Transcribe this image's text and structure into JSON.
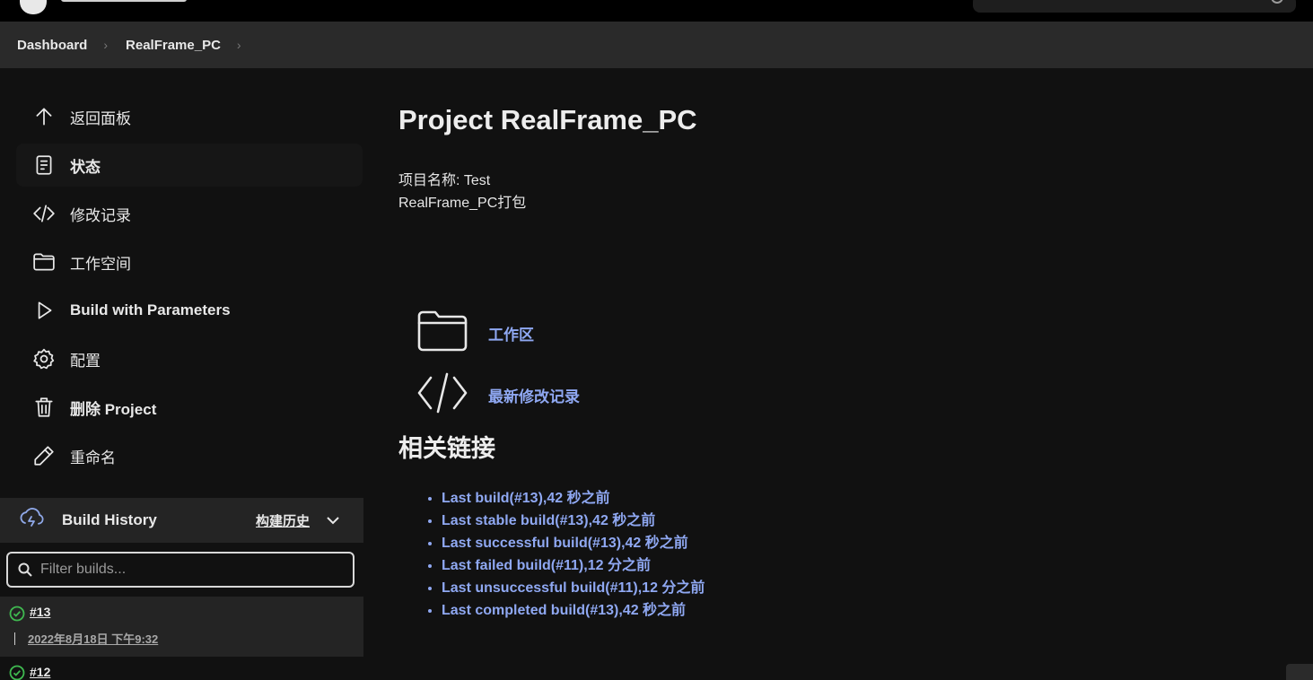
{
  "breadcrumb": {
    "items": [
      "Dashboard",
      "RealFrame_PC"
    ],
    "separator": "›"
  },
  "sidebar": {
    "items": [
      {
        "label": "返回面板",
        "icon": "arrow-up-icon"
      },
      {
        "label": "状态",
        "icon": "document-icon",
        "active": true
      },
      {
        "label": "修改记录",
        "icon": "code-icon"
      },
      {
        "label": "工作空间",
        "icon": "folder-icon"
      },
      {
        "label": "Build with Parameters",
        "icon": "play-icon"
      },
      {
        "label": "配置",
        "icon": "gear-icon"
      },
      {
        "label": "删除 Project",
        "icon": "trash-icon"
      },
      {
        "label": "重命名",
        "icon": "pencil-icon"
      }
    ]
  },
  "build_history": {
    "title": "Build History",
    "trend_label": "构建历史",
    "filter_placeholder": "Filter builds...",
    "builds": [
      {
        "number": "#13",
        "date": "2022年8月18日 下午9:32",
        "status": "success"
      },
      {
        "number": "#12",
        "status": "success"
      }
    ]
  },
  "main": {
    "title": "Project RealFrame_PC",
    "description_line1": "项目名称: Test",
    "description_line2": "RealFrame_PC打包",
    "workspace_link": "工作区",
    "changes_link": "最新修改记录",
    "related_title": "相关链接",
    "permalinks": [
      "Last build(#13),42 秒之前",
      "Last stable build(#13),42 秒之前",
      "Last successful build(#13),42 秒之前",
      "Last failed build(#11),12 分之前",
      "Last unsuccessful build(#11),12 分之前",
      "Last completed build(#13),42 秒之前"
    ]
  },
  "colors": {
    "background": "#111111",
    "link": "#8fa8f2",
    "success": "#3fb950",
    "breadcrumb_bg": "#2a2a2a"
  }
}
